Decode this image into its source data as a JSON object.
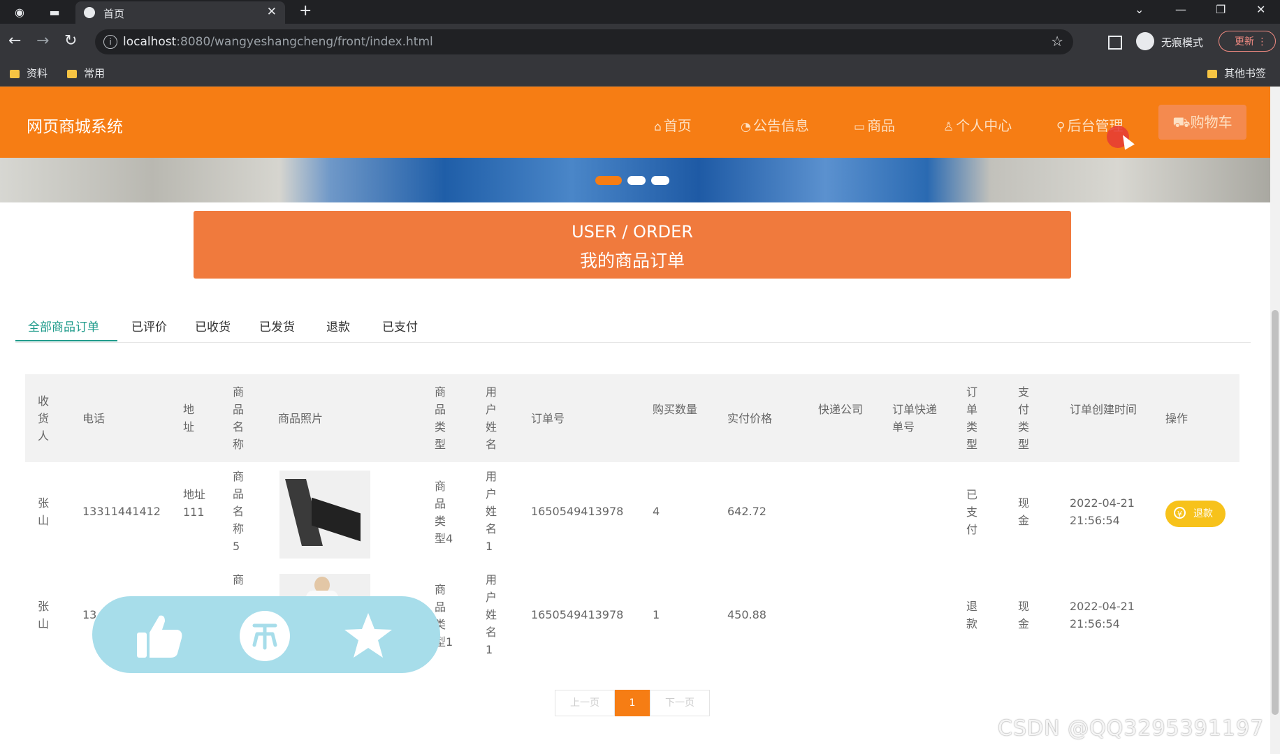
{
  "browser": {
    "tab_title": "首页",
    "url_host": "localhost",
    "url_rest": ":8080/wangyeshangcheng/front/index.html",
    "incognito_label": "无痕模式",
    "update_label": "更新",
    "bookmarks": [
      "资料",
      "常用"
    ],
    "other_bookmarks": "其他书签"
  },
  "site": {
    "logo": "网页商城系统",
    "nav": [
      {
        "label": "首页",
        "glyph": "⌂"
      },
      {
        "label": "公告信息",
        "glyph": "◔"
      },
      {
        "label": "商品",
        "glyph": "▭"
      },
      {
        "label": "个人中心",
        "glyph": "♙"
      },
      {
        "label": "后台管理",
        "glyph": "⚲"
      },
      {
        "label": "购物车",
        "glyph": "⛟"
      }
    ],
    "colors": {
      "header": "#f67d14",
      "banner": "#f07a3d",
      "accent": "#1f9b8b",
      "refund": "#f7c21b"
    }
  },
  "order_banner": {
    "en": "USER / ORDER",
    "cn": "我的商品订单"
  },
  "tabs": [
    "全部商品订单",
    "已评价",
    "已收货",
    "已发货",
    "退款",
    "已支付"
  ],
  "table": {
    "headers": [
      "收货人",
      "电话",
      "地址",
      "商品名称",
      "商品照片",
      "商品类型",
      "用户姓名",
      "订单号",
      "购买数量",
      "实付价格",
      "快递公司",
      "订单快递单号",
      "订单类型",
      "支付类型",
      "订单创建时间",
      "操作"
    ],
    "rows": [
      {
        "receiver": "张山",
        "phone": "13311441412",
        "address": "地址111",
        "product_name": "商品名称5",
        "product_type": "商品类型4",
        "user_name": "用户姓名1",
        "order_no": "1650549413978",
        "qty": "4",
        "price": "642.72",
        "courier": "",
        "tracking_no": "",
        "order_type": "已支付",
        "pay_type": "现金",
        "created": "2022-04-21 21:56:54",
        "action": "退款"
      },
      {
        "receiver": "张山",
        "phone": "13",
        "address": "",
        "product_name": "商",
        "product_type": "商品类型1",
        "user_name": "用户姓名1",
        "order_no": "1650549413978",
        "qty": "1",
        "price": "450.88",
        "courier": "",
        "tracking_no": "",
        "order_type": "退款",
        "pay_type": "现金",
        "created": "2022-04-21 21:56:54",
        "action": ""
      }
    ]
  },
  "pagination": {
    "prev": "上一页",
    "current": "1",
    "next": "下一页"
  },
  "watermark": "CSDN @QQ3295391197"
}
